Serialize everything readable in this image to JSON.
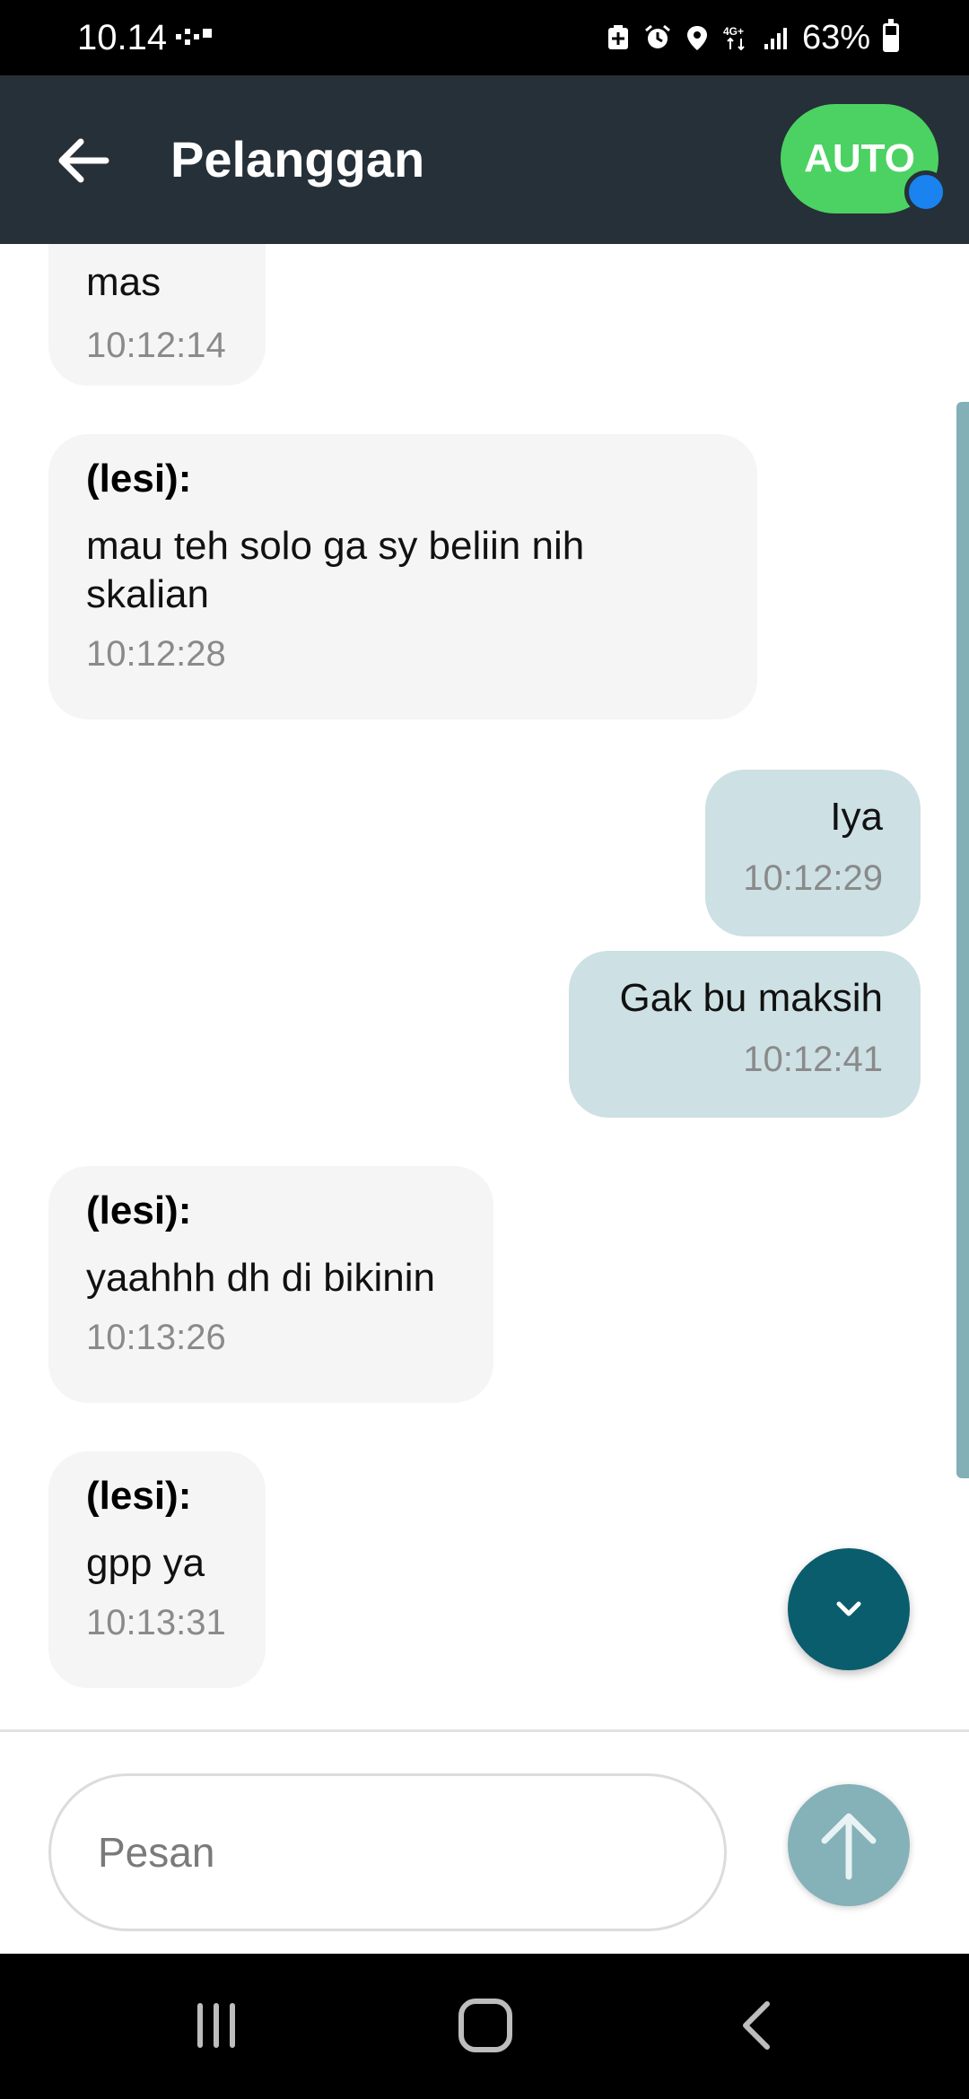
{
  "status_bar": {
    "time": "10.14",
    "network_label": "4G+",
    "battery_percent": "63%",
    "icons": [
      "notification-dots-icon",
      "battery-saver-icon",
      "alarm-icon",
      "location-icon",
      "network-4g-icon",
      "signal-icon",
      "battery-icon"
    ]
  },
  "app_bar": {
    "title": "Pelanggan",
    "auto_label": "AUTO",
    "back_icon": "arrow-left-icon",
    "auto_dot_color": "#1a83f0",
    "auto_color": "#4cd262",
    "background": "#263038"
  },
  "messages": [
    {
      "direction": "in",
      "sender": "",
      "text": "mas",
      "time": "10:12:14"
    },
    {
      "direction": "in",
      "sender": "(lesi):",
      "text": "mau teh solo ga sy beliin nih skalian",
      "time": "10:12:28"
    },
    {
      "direction": "out",
      "sender": "",
      "text": "Iya",
      "time": "10:12:29"
    },
    {
      "direction": "out",
      "sender": "",
      "text": "Gak bu maksih",
      "time": "10:12:41"
    },
    {
      "direction": "in",
      "sender": "(lesi):",
      "text": "yaahhh dh di bikinin",
      "time": "10:13:26"
    },
    {
      "direction": "in",
      "sender": "(lesi):",
      "text": "gpp ya",
      "time": "10:13:31"
    }
  ],
  "composer": {
    "placeholder": "Pesan",
    "send_icon": "arrow-up-icon",
    "scroll_down_icon": "chevron-down-icon"
  },
  "nav_bar": {
    "icons": [
      "recent-apps-icon",
      "home-icon",
      "back-icon"
    ]
  }
}
